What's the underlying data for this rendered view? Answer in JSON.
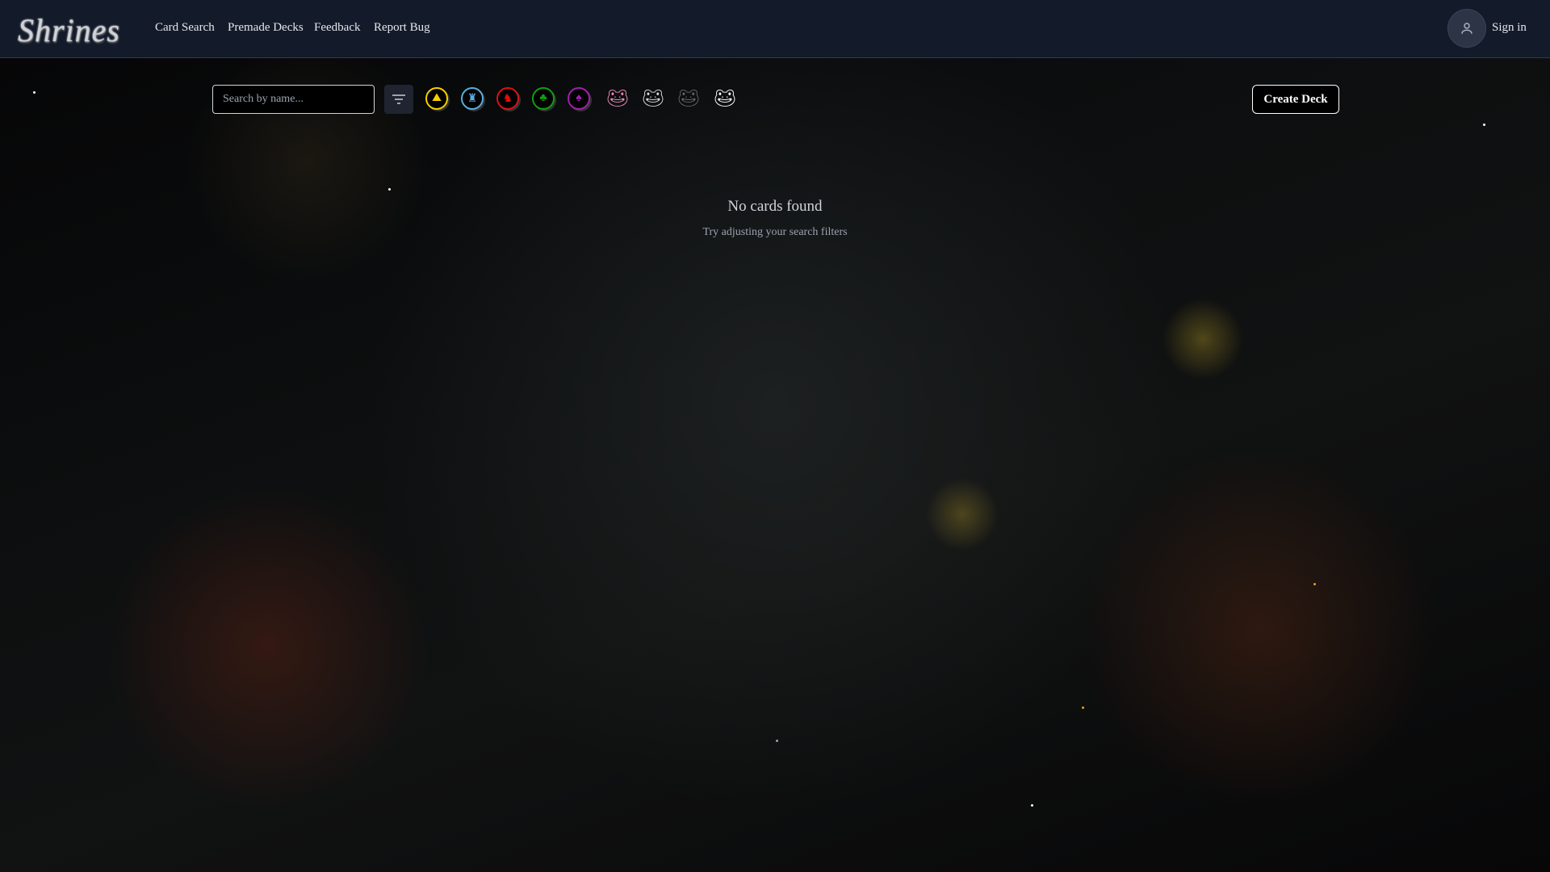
{
  "header": {
    "logo": "Shrines",
    "nav": [
      "Card Search",
      "Premade Decks",
      "Feedback",
      "Report Bug"
    ],
    "sign_in": "Sign in"
  },
  "toolbar": {
    "search_placeholder": "Search by name...",
    "create_deck": "Create Deck",
    "factions": [
      {
        "name": "yellow",
        "color": "#f5d000"
      },
      {
        "name": "blue",
        "color": "#5aaee0"
      },
      {
        "name": "red",
        "color": "#e01010"
      },
      {
        "name": "green",
        "color": "#10a010"
      },
      {
        "name": "purple",
        "color": "#a020b0"
      }
    ],
    "frogs": [
      {
        "name": "pink",
        "color": "#f08cb8"
      },
      {
        "name": "light-gray",
        "color": "#dcdcdc"
      },
      {
        "name": "dark-gray",
        "color": "#666666"
      },
      {
        "name": "white",
        "color": "#ffffff"
      }
    ]
  },
  "empty": {
    "title": "No cards found",
    "subtitle": "Try adjusting your search filters"
  }
}
